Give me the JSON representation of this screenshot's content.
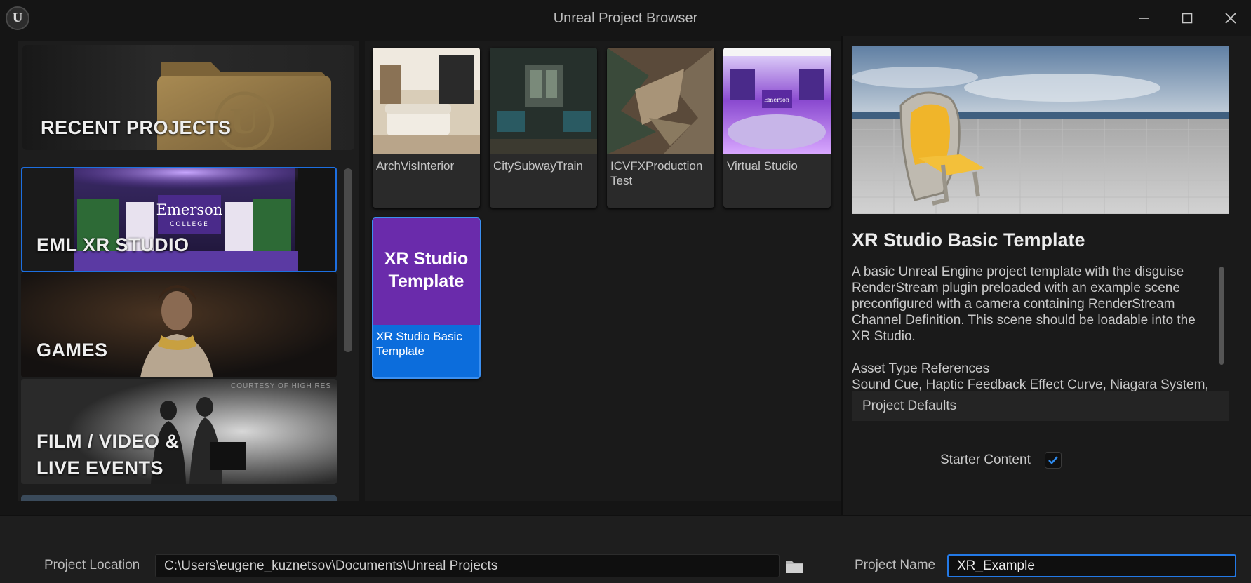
{
  "window": {
    "title": "Unreal Project Browser",
    "logo_glyph": "U",
    "controls": [
      "minimize-icon",
      "maximize-icon",
      "close-icon"
    ]
  },
  "categories": {
    "recent": {
      "label": "RECENT PROJECTS",
      "icon": "folder-icon"
    },
    "items": [
      {
        "label": "EML XR STUDIO",
        "sign_line1": "Emerson",
        "sign_line2": "COLLEGE",
        "selected": true
      },
      {
        "label": "GAMES",
        "selected": false
      },
      {
        "label_line1": "FILM / VIDEO &",
        "label_line2": "LIVE EVENTS",
        "credit": "COURTESY OF HIGH RES",
        "selected": false
      }
    ]
  },
  "templates": [
    {
      "label": "ArchVisInterior",
      "selected": false
    },
    {
      "label": "CitySubwayTrain",
      "selected": false
    },
    {
      "label": "ICVFXProduction Test",
      "selected": false
    },
    {
      "label": "Virtual Studio",
      "thumb_text": "Emerson",
      "selected": false
    },
    {
      "label": "XR Studio Basic Template",
      "thumb_line1": "XR Studio",
      "thumb_line2": "Template",
      "selected": true
    }
  ],
  "details": {
    "title": "XR Studio Basic Template",
    "description": "A basic Unreal Engine project template with the disguise RenderStream plugin preloaded with an example scene preconfigured with a camera containing RenderStream Channel Definition. This scene should be loadable into the XR Studio.",
    "asset_heading": "Asset Type References",
    "asset_list": "Sound Cue, Haptic Feedback Effect Curve, Niagara System,",
    "project_defaults": "Project Defaults",
    "starter_content_label": "Starter Content",
    "starter_content_checked": true
  },
  "bottom": {
    "location_label": "Project Location",
    "location_value": "C:\\Users\\eugene_kuznetsov\\Documents\\Unreal Projects",
    "name_label": "Project Name",
    "name_value": "XR_Example"
  },
  "colors": {
    "accent": "#1d6fe0",
    "background": "#151515",
    "selected_tile": "#0c6ddc",
    "xr_template_purple": "#6a2bab"
  }
}
